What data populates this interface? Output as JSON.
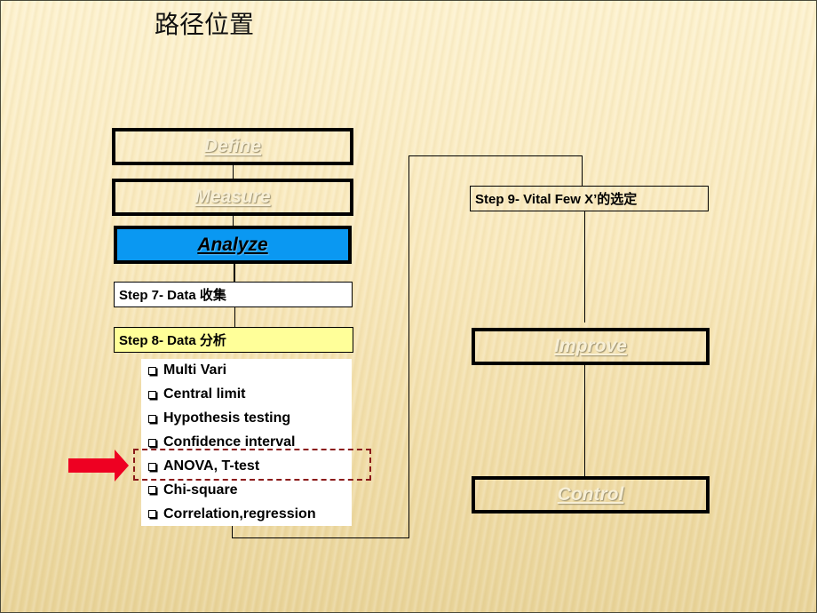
{
  "title": "路径位置",
  "phases": {
    "define": "Define",
    "measure": "Measure",
    "analyze": "Analyze",
    "improve": "Improve",
    "control": "Control"
  },
  "steps": {
    "step7": "Step 7- Data 收集",
    "step8": "Step 8- Data 分析",
    "step9": "Step 9- Vital Few X’的选定"
  },
  "analysis_tools": [
    "Multi Vari",
    "Central limit",
    "Hypothesis testing",
    "Confidence interval",
    "ANOVA, T-test",
    "Chi-square",
    "Correlation,regression"
  ],
  "highlighted_tool": "ANOVA, T-test",
  "colors": {
    "active_phase": "#0a98f2",
    "step8_fill": "#ffff99",
    "pointer_arrow": "#ee0022",
    "highlight_border": "#8b1a1a"
  }
}
